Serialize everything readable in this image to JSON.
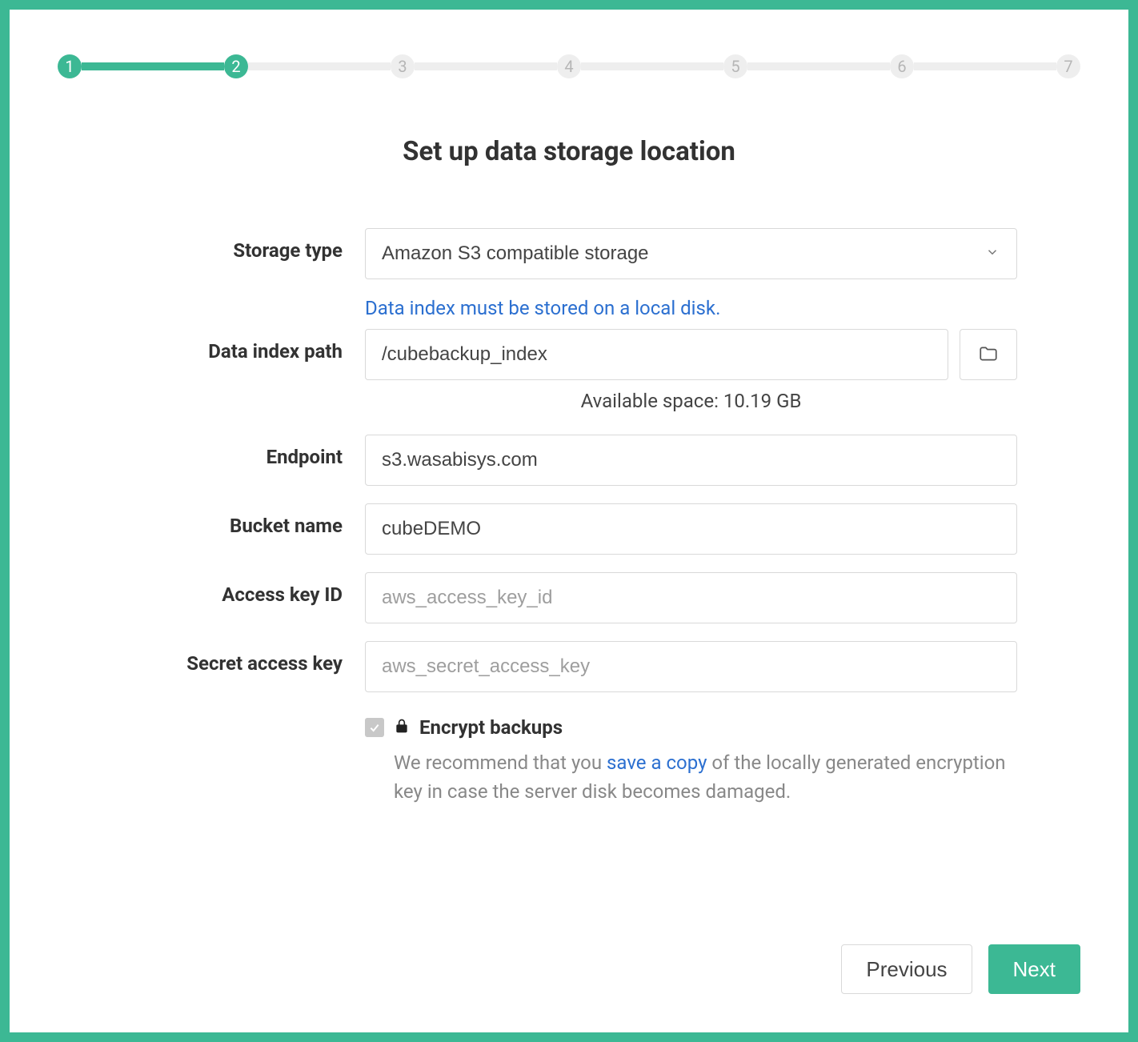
{
  "stepper": {
    "steps": [
      {
        "num": "1",
        "state": "active"
      },
      {
        "num": "2",
        "state": "active"
      },
      {
        "num": "3",
        "state": "inactive"
      },
      {
        "num": "4",
        "state": "inactive"
      },
      {
        "num": "5",
        "state": "inactive"
      },
      {
        "num": "6",
        "state": "inactive"
      },
      {
        "num": "7",
        "state": "inactive"
      }
    ]
  },
  "title": "Set up data storage location",
  "form": {
    "storage_type": {
      "label": "Storage type",
      "value": "Amazon S3 compatible storage"
    },
    "data_index": {
      "label": "Data index path",
      "note": "Data index must be stored on a local disk.",
      "value": "/cubebackup_index",
      "available": "Available space: 10.19 GB"
    },
    "endpoint": {
      "label": "Endpoint",
      "value": "s3.wasabisys.com"
    },
    "bucket": {
      "label": "Bucket name",
      "value": "cubeDEMO"
    },
    "access_key": {
      "label": "Access key ID",
      "placeholder": "aws_access_key_id",
      "value": ""
    },
    "secret_key": {
      "label": "Secret access key",
      "placeholder": "aws_secret_access_key",
      "value": ""
    },
    "encrypt": {
      "label": "Encrypt backups",
      "checked": true,
      "help_prefix": "We recommend that you ",
      "help_link": "save a copy",
      "help_suffix": " of the locally generated encryption key in case the server disk becomes damaged."
    }
  },
  "buttons": {
    "previous": "Previous",
    "next": "Next"
  }
}
